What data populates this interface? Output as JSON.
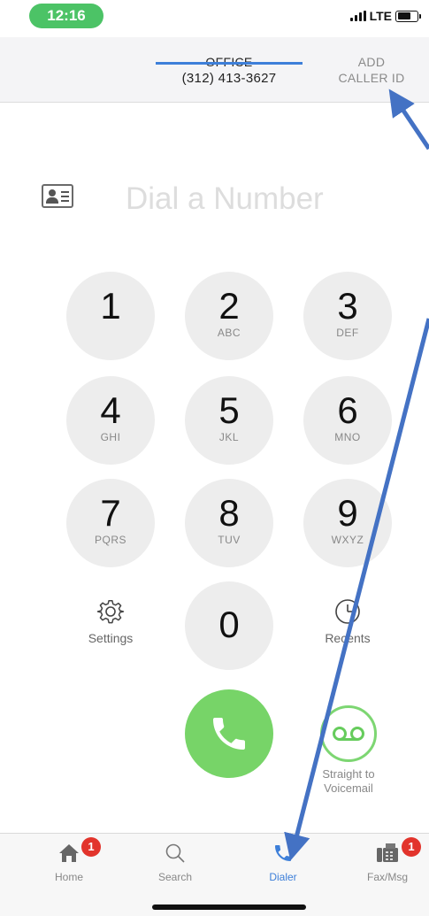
{
  "status_bar": {
    "time": "12:16",
    "network": "LTE"
  },
  "caller_id": {
    "office_label": "OFFICE",
    "office_number": "(312) 413-3627",
    "add_label_line1": "ADD",
    "add_label_line2": "CALLER ID"
  },
  "dial_input": {
    "placeholder": "Dial a Number",
    "value": ""
  },
  "keypad": [
    {
      "digit": "1",
      "letters": ""
    },
    {
      "digit": "2",
      "letters": "ABC"
    },
    {
      "digit": "3",
      "letters": "DEF"
    },
    {
      "digit": "4",
      "letters": "GHI"
    },
    {
      "digit": "5",
      "letters": "JKL"
    },
    {
      "digit": "6",
      "letters": "MNO"
    },
    {
      "digit": "7",
      "letters": "PQRS"
    },
    {
      "digit": "8",
      "letters": "TUV"
    },
    {
      "digit": "9",
      "letters": "WXYZ"
    },
    {
      "digit": "0",
      "letters": ""
    }
  ],
  "side_buttons": {
    "settings_label": "Settings",
    "recents_label": "Recents"
  },
  "voicemail": {
    "label_line1": "Straight to",
    "label_line2": "Voicemail"
  },
  "tabs": [
    {
      "label": "Home",
      "badge": "1"
    },
    {
      "label": "Search",
      "badge": ""
    },
    {
      "label": "Dialer",
      "badge": ""
    },
    {
      "label": "Fax/Msg",
      "badge": "1"
    }
  ],
  "colors": {
    "accent": "#3d7fd9",
    "call_green": "#77d468",
    "status_green": "#4cc366",
    "badge_red": "#e2342c",
    "annotation_blue": "#4472c4"
  }
}
